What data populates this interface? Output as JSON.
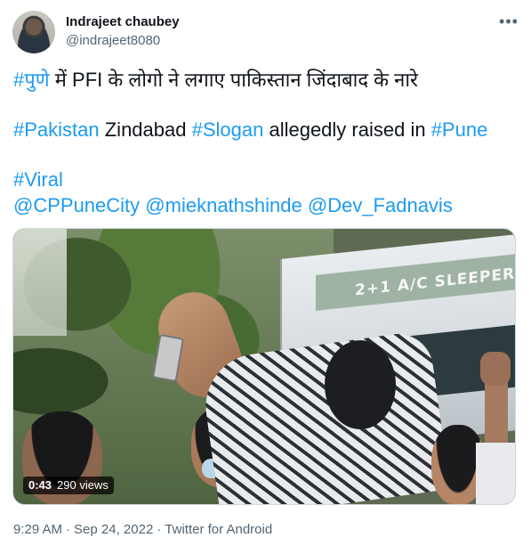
{
  "author": {
    "name": "Indrajeet chaubey",
    "handle": "@indrajeet8080"
  },
  "tweet": {
    "line1_hashtag": "#पुणे",
    "line1_text": " में PFI के लोगो ने लगाए पाकिस्तान जिंदाबाद के नारे",
    "line2_hashtag1": "#Pakistan",
    "line2_text1": " Zindabad ",
    "line2_hashtag2": "#Slogan",
    "line2_text2": " allegedly raised in ",
    "line2_hashtag3": "#Pune",
    "line3_hashtag": "#Viral",
    "mention1": "@CPPuneCity",
    "mention2": "@mieknathshinde",
    "mention3": "@Dev_Fadnavis"
  },
  "media": {
    "bus_sign": "2+1 A/C SLEEPER",
    "duration": "0:43",
    "views": "290 views"
  },
  "meta": {
    "time": "9:29 AM",
    "separator": "·",
    "date": "Sep 24, 2022",
    "source": "Twitter for Android"
  },
  "icons": {
    "more": "more-horizontal-icon"
  },
  "colors": {
    "link": "#1d9bf0",
    "secondary_text": "#536471",
    "primary_text": "#0f1419"
  }
}
